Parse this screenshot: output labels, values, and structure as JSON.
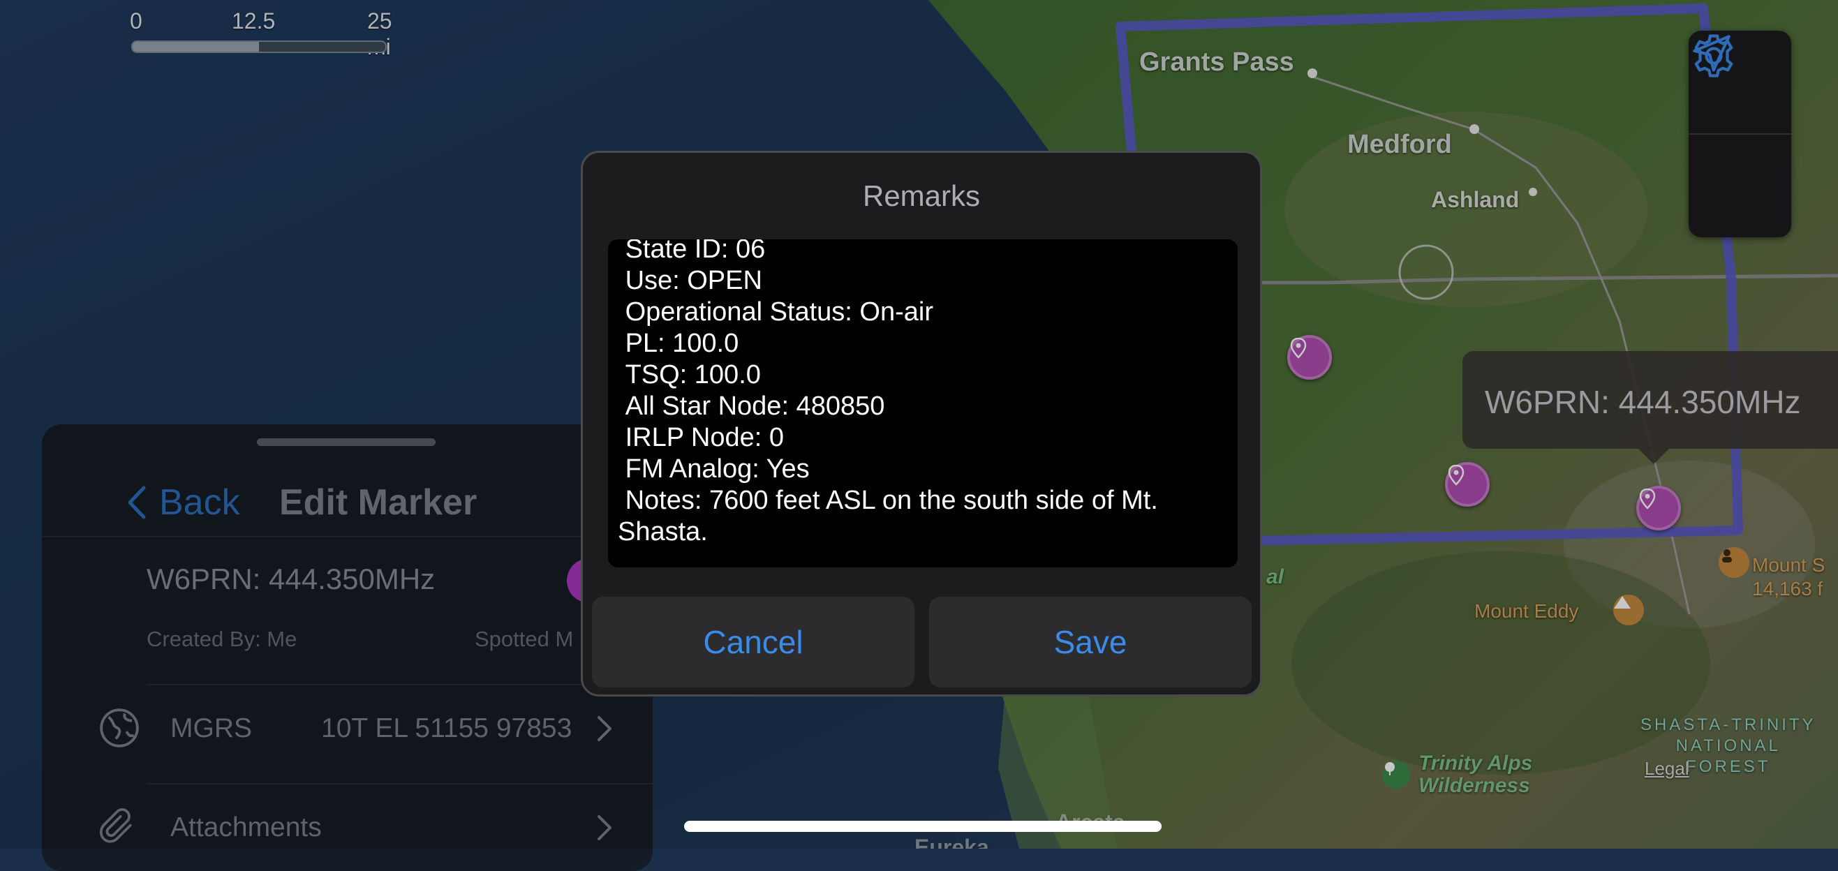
{
  "map": {
    "scale": {
      "ticks": [
        "0",
        "12.5",
        "25 mi"
      ]
    },
    "labels": {
      "grants_pass": "Grants Pass",
      "medford": "Medford",
      "ashland": "Ashland",
      "mount_eddy": "Mount Eddy",
      "mount_shasta": "Mount S",
      "mount_shasta_elev": "14,163 f",
      "trinity_alps": "Trinity Alps\nWilderness",
      "forest": "SHASTA-TRINITY\nNATIONAL\nFOREST",
      "legal": "Legal",
      "partial_al": "al",
      "arcata": "Arcata",
      "eureka": "Eureka"
    },
    "callout": "W6PRN: 444.350MHz",
    "controls": [
      "gear-icon",
      "location-arrow-icon"
    ]
  },
  "sheet": {
    "back_label": "Back",
    "title": "Edit Marker",
    "marker_name": "W6PRN: 444.350MHz",
    "marker_color": "#b137c7",
    "created_by": "Created By: Me",
    "spotted": "Spotted M",
    "rows": [
      {
        "label": "MGRS",
        "value": "10T EL 51155 97853",
        "icon": "globe-icon"
      },
      {
        "label": "Attachments",
        "value": "",
        "icon": "paperclip-icon"
      }
    ]
  },
  "dialog": {
    "title": "Remarks",
    "text": " State ID: 06\n Use: OPEN\n Operational Status: On-air\n PL: 100.0\n TSQ: 100.0\n All Star Node: 480850\n IRLP Node: 0\n FM Analog: Yes\n Notes: 7600 feet ASL on the south side of Mt.\nShasta.",
    "cancel_label": "Cancel",
    "save_label": "Save"
  },
  "colors": {
    "accent_blue": "#3b8beb",
    "pin_purple": "#b04db0",
    "boundary": "#5a5bc4"
  }
}
